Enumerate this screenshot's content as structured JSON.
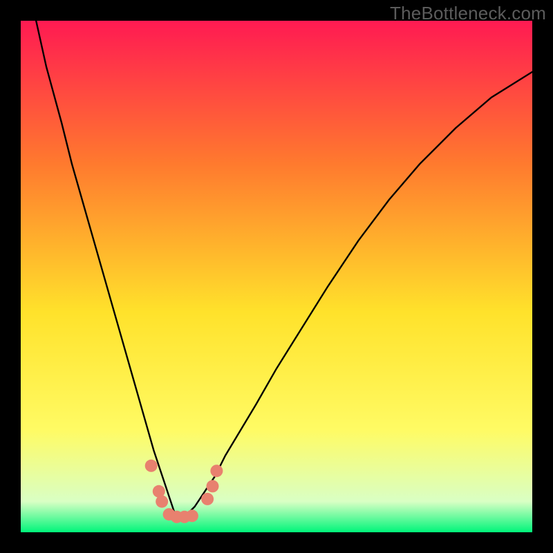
{
  "watermark": "TheBottleneck.com",
  "chart_data": {
    "type": "line",
    "title": "",
    "xlabel": "",
    "ylabel": "",
    "xlim": [
      0,
      100
    ],
    "ylim": [
      0,
      100
    ],
    "background_gradient": {
      "top": "#ff1a52",
      "mid1": "#ff7a2e",
      "mid2": "#ffe22b",
      "mid3": "#fffb64",
      "mid4": "#d9ffc4",
      "bottom": "#00f57a"
    },
    "curve": {
      "description": "V-shaped bottleneck curve with minimum near x≈31",
      "x": [
        3,
        5,
        8,
        10,
        12,
        14,
        16,
        18,
        20,
        22,
        24,
        26,
        28,
        29,
        30,
        31,
        32,
        33,
        34,
        36,
        38,
        40,
        43,
        46,
        50,
        55,
        60,
        66,
        72,
        78,
        85,
        92,
        100
      ],
      "y": [
        100,
        91,
        80,
        72,
        65,
        58,
        51,
        44,
        37,
        30,
        23,
        16,
        10,
        7,
        4,
        3,
        3,
        4,
        5,
        8,
        11,
        15,
        20,
        25,
        32,
        40,
        48,
        57,
        65,
        72,
        79,
        85,
        90
      ]
    },
    "markers": {
      "color": "#e8816f",
      "radius": 9,
      "points": [
        {
          "x": 25.5,
          "y": 13
        },
        {
          "x": 27.0,
          "y": 8
        },
        {
          "x": 27.6,
          "y": 6
        },
        {
          "x": 29.0,
          "y": 3.5
        },
        {
          "x": 30.5,
          "y": 3
        },
        {
          "x": 32.0,
          "y": 3
        },
        {
          "x": 33.5,
          "y": 3.2
        },
        {
          "x": 36.5,
          "y": 6.5
        },
        {
          "x": 37.5,
          "y": 9
        },
        {
          "x": 38.3,
          "y": 12
        }
      ]
    }
  }
}
